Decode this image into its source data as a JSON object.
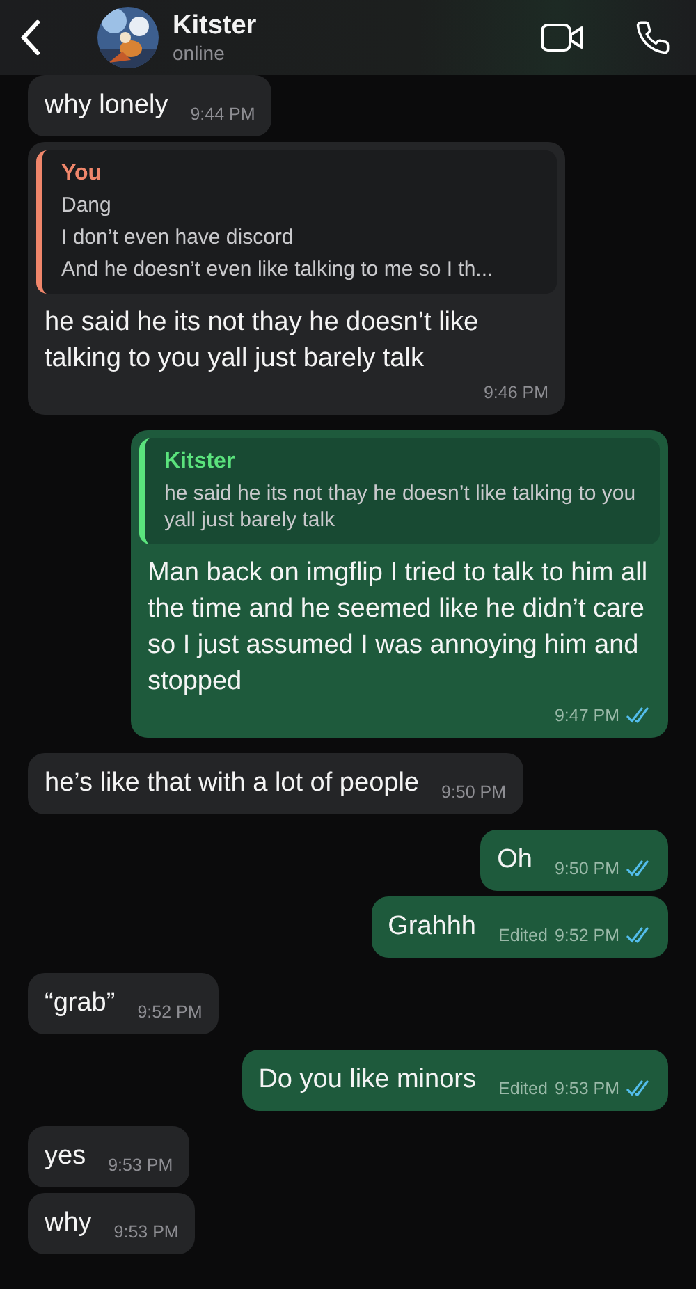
{
  "header": {
    "name": "Kitster",
    "status": "online"
  },
  "messages": [
    {
      "outgoing": false,
      "text": "why lonely",
      "time": "9:44 PM"
    },
    {
      "outgoing": false,
      "quote": {
        "author": "You",
        "lines": [
          "Dang",
          "I don’t even have discord",
          "And he doesn’t even like talking to me so I th..."
        ]
      },
      "text": "he said he its not thay he doesn’t like talking to you yall just barely talk",
      "time": "9:46 PM"
    },
    {
      "outgoing": true,
      "quote": {
        "author": "Kitster",
        "lines": [
          "he said he its not thay he doesn’t like talking to you yall just barely talk"
        ]
      },
      "text": "Man back on imgflip I tried to talk to him all the time and he seemed like he didn’t care so I just assumed I was annoying him and stopped",
      "time": "9:47 PM",
      "read": true
    },
    {
      "outgoing": false,
      "text": "he’s like that with a lot of people",
      "time": "9:50 PM"
    },
    {
      "outgoing": true,
      "text": "Oh",
      "time": "9:50 PM",
      "read": true
    },
    {
      "outgoing": true,
      "text": "Grahhh",
      "edited": "Edited",
      "time": "9:52 PM",
      "read": true
    },
    {
      "outgoing": false,
      "text": "“grab”",
      "time": "9:52 PM"
    },
    {
      "outgoing": true,
      "text": "Do you like minors",
      "edited": "Edited",
      "time": "9:53 PM",
      "read": true
    },
    {
      "outgoing": false,
      "text": "yes",
      "time": "9:53 PM"
    },
    {
      "outgoing": false,
      "text": "why",
      "time": "9:53 PM"
    }
  ]
}
